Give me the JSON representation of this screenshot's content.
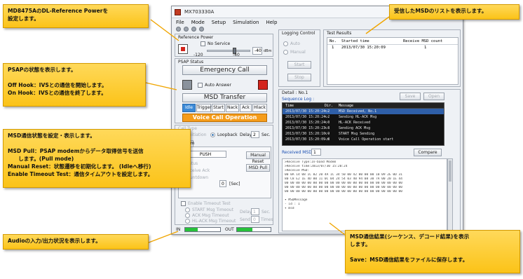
{
  "window": {
    "title": "MX703330A",
    "menu": [
      "File",
      "Mode",
      "Setup",
      "Simulation",
      "Help"
    ],
    "controls": [
      "–",
      "□",
      "×"
    ]
  },
  "reference_power": {
    "title": "Reference Power",
    "no_service": "No Service",
    "min": "-120",
    "value": "-40",
    "max": "-40",
    "unit": "dBm",
    "level": 0.65
  },
  "psap": {
    "title": "PSAP Status",
    "emergency_call": "Emergency Call",
    "auto_answer": "Auto Answer",
    "msd_transfer": "MSD Transfer",
    "states": [
      "Idle",
      "Trigger",
      "Start",
      "Nack",
      "Ack",
      "Hlack"
    ],
    "active_state": "Idle",
    "voice_call": "Voice Call Operation"
  },
  "msd_control": {
    "call_type": "Call Type",
    "initiation": "Initiation",
    "loopback": "Loopback",
    "delay_label": "Delay",
    "delay_value": "2",
    "sec": "Sec.",
    "modem_tab": "Modem",
    "mode": "PUSH",
    "manual_reset": "Manual Reset",
    "msd_pull": "MSD Pull",
    "status": "Status",
    "receive_ack": "Receive Ack",
    "countdown": "Countdown",
    "seconds": "0",
    "sec_unit": "[Sec]",
    "enable_timeout": "Enable Timeout Test",
    "start_timeout": "START Msg Timeout",
    "ack_timeout": "ACK Msg Timeout",
    "hlack_timeout": "HL-ACK Msg Timeout",
    "delay2_label": "Delay",
    "delay2_value": "1",
    "send_label": "Send",
    "send_value": "0",
    "times": "Times"
  },
  "audio": {
    "in_label": "IN",
    "out_label": "OUT",
    "in_level": 0.35,
    "out_level": 0.45
  },
  "logging": {
    "title": "Logging Control",
    "auto": "Auto",
    "manual": "Manual",
    "start": "Start",
    "stop": "Stop"
  },
  "test_results": {
    "title": "Test Results",
    "headers": [
      "No.",
      "Started time",
      "Receive MSD count"
    ],
    "rows": [
      [
        "1",
        "2013/07/30 15:20:09",
        "1"
      ]
    ]
  },
  "detail": {
    "title": "Detail : No.1",
    "sequence_log": "Sequence Log :",
    "save": "Save",
    "open": "Open",
    "headers": [
      "Time",
      "Dir.",
      "Message"
    ],
    "rows": [
      [
        "2013/07/30 15:20:24.2",
        "<-",
        "MSD Received, No.1"
      ],
      [
        "2013/07/30 15:20:24.2",
        "<-",
        "Sending HL-ACK Msg"
      ],
      [
        "2013/07/30 15:20:24.0",
        "<-",
        "HL-ACK Received"
      ],
      [
        "2013/07/30 15:20:23.8",
        "<-",
        "Sending ACK Msg"
      ],
      [
        "2013/07/30 15:20:10.9",
        "<-",
        "START Msg Sending"
      ],
      [
        "2013/07/30 15:20:09.8",
        "->",
        "Voice Call Operation start"
      ]
    ],
    "received_msd": "Received MSD",
    "msd_no": "1",
    "compare": "Compare",
    "msd_lines": [
      ">Receive Type:In-band Modem",
      ">Receive time:2013/07/30 15:20:24",
      ">Receive MSD:",
      "00 0A 14 08 1C 02 20 4A 1C 34 50 00 42 00 00 00 10 09 2E 0D 31",
      "80 C8 E2 1E 4D 00 11 0C 04 24 54 03 40 94 08 30 7A 00 20 1E 44",
      "00 00 00 00 00 00 00 00 00 00 00 00 00 00 00 00 00 00 00 00 00",
      "00 00 00 00 00 00 00 00 00 00 00 00 00 00 00 00 00 00 00 00 00",
      "00 00 00 00 00 00 00 00 00 00 00 00 00 00 00 00 00 00 00 00 00",
      "",
      "▾ MSDMessage",
      "   - id : 1",
      "   ▾ msd"
    ]
  },
  "callouts": {
    "ref_power": [
      "MD8475AのDL-Reference Powerを",
      "設定します。"
    ],
    "msd_list": [
      "受信したMSDのリストを表示します。"
    ],
    "psap": [
      "PSAPの状態を表示します。",
      "",
      "Off Hook：IVSとの通信を開始します。",
      "On Hook：IVSとの通信を終了します。"
    ],
    "msd_comm": [
      "MSD通信状態を設定・表示します。",
      "",
      "MSD Pull：PSAP modemからデータ取得信号を送信",
      "　　します。(Pull mode)",
      "Manual Reset：状態遷移を初期化します。 (Idleへ移行)",
      "Enable Timeout Test：通信タイムアウトを設定します。"
    ],
    "audio": [
      "Audioの入力/出力状況を表示します。"
    ],
    "msd_result": [
      "MSD通信結果(シーケンス、デコード結果)を表示",
      "します。",
      "",
      "Save：MSD通信結果をファイルに保存します。"
    ]
  }
}
